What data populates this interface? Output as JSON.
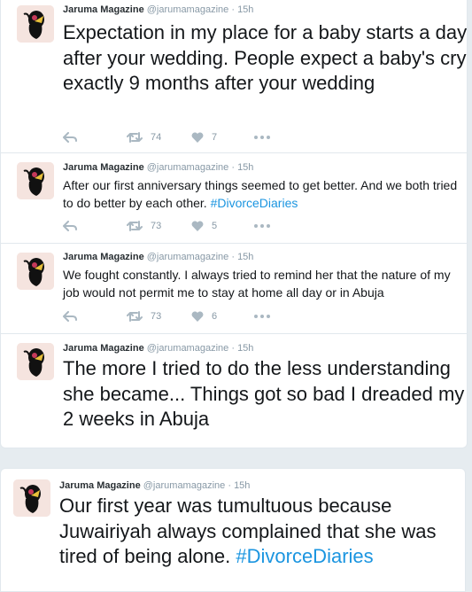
{
  "tweets": [
    {
      "name": "Jaruma Magazine",
      "handle": "@jarumamagazine",
      "time": "15h",
      "text": "Expectation in my place for a baby starts a day after your wedding. People expect a baby's cry exactly 9 months after your wedding",
      "retweets": "74",
      "likes": "7"
    },
    {
      "name": "Jaruma Magazine",
      "handle": "@jarumamagazine",
      "time": "15h",
      "text": "After our first anniversary things seemed to get better. And we both tried to do better by each other. ",
      "hashtag": "#DivorceDiaries",
      "retweets": "73",
      "likes": "5"
    },
    {
      "name": "Jaruma Magazine",
      "handle": "@jarumamagazine",
      "time": "15h",
      "text": "We fought constantly. I always tried to remind her that the nature of my job would not permit me to stay at home all day or in Abuja",
      "retweets": "73",
      "likes": "6"
    },
    {
      "name": "Jaruma Magazine",
      "handle": "@jarumamagazine",
      "time": "15h",
      "text": "The more I tried to do the less understanding she became... Things got so bad I dreaded my 2 weeks in Abuja"
    },
    {
      "name": "Jaruma Magazine",
      "handle": "@jarumamagazine",
      "time": "15h",
      "text": "Our first year was tumultuous because Juwairiyah always complained that she was tired of being alone. ",
      "hashtag": "#DivorceDiaries"
    }
  ],
  "separator": "·",
  "icons": {
    "avatar": "jaruma-logo-icon",
    "reply": "reply-icon",
    "retweet": "retweet-icon",
    "like": "heart-icon",
    "more": "more-icon"
  },
  "colors": {
    "hashtag": "#1b95e0",
    "meta": "#8899a6",
    "icon": "#aab8c2",
    "avatar_bg": "#f5e4df"
  }
}
